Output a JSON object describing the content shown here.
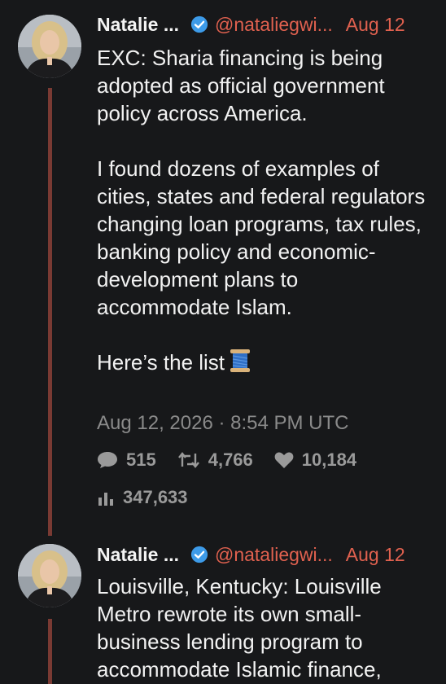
{
  "tweets": [
    {
      "author_name": "Natalie ...",
      "handle": "@nataliegwi...",
      "date": "Aug 12",
      "paragraphs": [
        "EXC: Sharia financing is being adopted as official government policy across America.",
        "I found dozens of examples of cities, states and federal regulators changing loan programs, tax rules, banking policy and economic-development plans to accommodate Islam.",
        "Here’s the list"
      ],
      "emoji": "spool-of-thread-emoji",
      "timestamp": "Aug 12, 2026 · 8:54 PM UTC",
      "replies": "515",
      "retweets": "4,766",
      "likes": "10,184",
      "views": "347,633"
    },
    {
      "author_name": "Natalie ...",
      "handle": "@nataliegwi...",
      "date": "Aug 12",
      "text": "Louisville, Kentucky: Louisville Metro rewrote its own small-business lending program to accommodate Islamic finance,"
    }
  ],
  "colors": {
    "background": "#17181a",
    "accent": "#e0614f",
    "thread_line": "#7a3a33",
    "verified": "#3d9be9",
    "muted": "#8a8a8a"
  },
  "icons": [
    "verified-badge-icon",
    "comment-icon",
    "retweet-icon",
    "heart-icon",
    "views-chart-icon",
    "spool-of-thread-emoji"
  ]
}
